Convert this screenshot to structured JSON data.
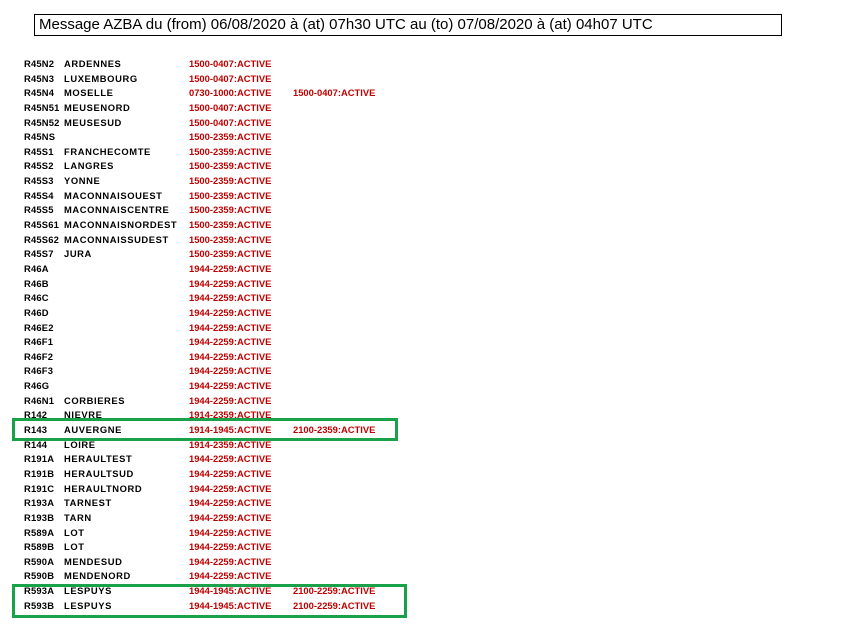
{
  "header": {
    "title": "Message AZBA du (from) 06/08/2020 à (at) 07h30 UTC au (to) 07/08/2020 à (at) 04h07 UTC"
  },
  "colors": {
    "active_text": "#c00000",
    "highlight_border": "#1aa24a"
  },
  "zones": [
    {
      "code": "R45N2",
      "name": "ARDENNES",
      "p1": "1500-0407:ACTIVE",
      "p2": ""
    },
    {
      "code": "R45N3",
      "name": "LUXEMBOURG",
      "p1": "1500-0407:ACTIVE",
      "p2": ""
    },
    {
      "code": "R45N4",
      "name": "MOSELLE",
      "p1": "0730-1000:ACTIVE",
      "p2": "1500-0407:ACTIVE"
    },
    {
      "code": "R45N51",
      "name": "MEUSENORD",
      "p1": "1500-0407:ACTIVE",
      "p2": ""
    },
    {
      "code": "R45N52",
      "name": "MEUSESUD",
      "p1": "1500-0407:ACTIVE",
      "p2": ""
    },
    {
      "code": "R45NS",
      "name": "",
      "p1": "1500-2359:ACTIVE",
      "p2": ""
    },
    {
      "code": "R45S1",
      "name": "FRANCHECOMTE",
      "p1": "1500-2359:ACTIVE",
      "p2": ""
    },
    {
      "code": "R45S2",
      "name": "LANGRES",
      "p1": "1500-2359:ACTIVE",
      "p2": ""
    },
    {
      "code": "R45S3",
      "name": "YONNE",
      "p1": "1500-2359:ACTIVE",
      "p2": ""
    },
    {
      "code": "R45S4",
      "name": "MACONNAISOUEST",
      "p1": "1500-2359:ACTIVE",
      "p2": ""
    },
    {
      "code": "R45S5",
      "name": "MACONNAISCENTRE",
      "p1": "1500-2359:ACTIVE",
      "p2": ""
    },
    {
      "code": "R45S61",
      "name": "MACONNAISNORDEST",
      "p1": "1500-2359:ACTIVE",
      "p2": ""
    },
    {
      "code": "R45S62",
      "name": "MACONNAISSUDEST",
      "p1": "1500-2359:ACTIVE",
      "p2": ""
    },
    {
      "code": "R45S7",
      "name": "JURA",
      "p1": "1500-2359:ACTIVE",
      "p2": ""
    },
    {
      "code": "R46A",
      "name": "",
      "p1": "1944-2259:ACTIVE",
      "p2": ""
    },
    {
      "code": "R46B",
      "name": "",
      "p1": "1944-2259:ACTIVE",
      "p2": ""
    },
    {
      "code": "R46C",
      "name": "",
      "p1": "1944-2259:ACTIVE",
      "p2": ""
    },
    {
      "code": "R46D",
      "name": "",
      "p1": "1944-2259:ACTIVE",
      "p2": ""
    },
    {
      "code": "R46E2",
      "name": "",
      "p1": "1944-2259:ACTIVE",
      "p2": ""
    },
    {
      "code": "R46F1",
      "name": "",
      "p1": "1944-2259:ACTIVE",
      "p2": ""
    },
    {
      "code": "R46F2",
      "name": "",
      "p1": "1944-2259:ACTIVE",
      "p2": ""
    },
    {
      "code": "R46F3",
      "name": "",
      "p1": "1944-2259:ACTIVE",
      "p2": ""
    },
    {
      "code": "R46G",
      "name": "",
      "p1": "1944-2259:ACTIVE",
      "p2": ""
    },
    {
      "code": "R46N1",
      "name": "CORBIERES",
      "p1": "1944-2259:ACTIVE",
      "p2": ""
    },
    {
      "code": "R142",
      "name": "NIEVRE",
      "p1": "1914-2359:ACTIVE",
      "p2": ""
    },
    {
      "code": "R143",
      "name": "AUVERGNE",
      "p1": "1914-1945:ACTIVE",
      "p2": "2100-2359:ACTIVE"
    },
    {
      "code": "R144",
      "name": "LOIRE",
      "p1": "1914-2359:ACTIVE",
      "p2": ""
    },
    {
      "code": "R191A",
      "name": "HERAULTEST",
      "p1": "1944-2259:ACTIVE",
      "p2": ""
    },
    {
      "code": "R191B",
      "name": "HERAULTSUD",
      "p1": "1944-2259:ACTIVE",
      "p2": ""
    },
    {
      "code": "R191C",
      "name": "HERAULTNORD",
      "p1": "1944-2259:ACTIVE",
      "p2": ""
    },
    {
      "code": "R193A",
      "name": "TARNEST",
      "p1": "1944-2259:ACTIVE",
      "p2": ""
    },
    {
      "code": "R193B",
      "name": "TARN",
      "p1": "1944-2259:ACTIVE",
      "p2": ""
    },
    {
      "code": "R589A",
      "name": "LOT",
      "p1": "1944-2259:ACTIVE",
      "p2": ""
    },
    {
      "code": "R589B",
      "name": "LOT",
      "p1": "1944-2259:ACTIVE",
      "p2": ""
    },
    {
      "code": "R590A",
      "name": "MENDESUD",
      "p1": "1944-2259:ACTIVE",
      "p2": ""
    },
    {
      "code": "R590B",
      "name": "MENDENORD",
      "p1": "1944-2259:ACTIVE",
      "p2": ""
    },
    {
      "code": "R593A",
      "name": "LESPUYS",
      "p1": "1944-1945:ACTIVE",
      "p2": "2100-2259:ACTIVE"
    },
    {
      "code": "R593B",
      "name": "LESPUYS",
      "p1": "1944-1945:ACTIVE",
      "p2": "2100-2259:ACTIVE"
    }
  ]
}
